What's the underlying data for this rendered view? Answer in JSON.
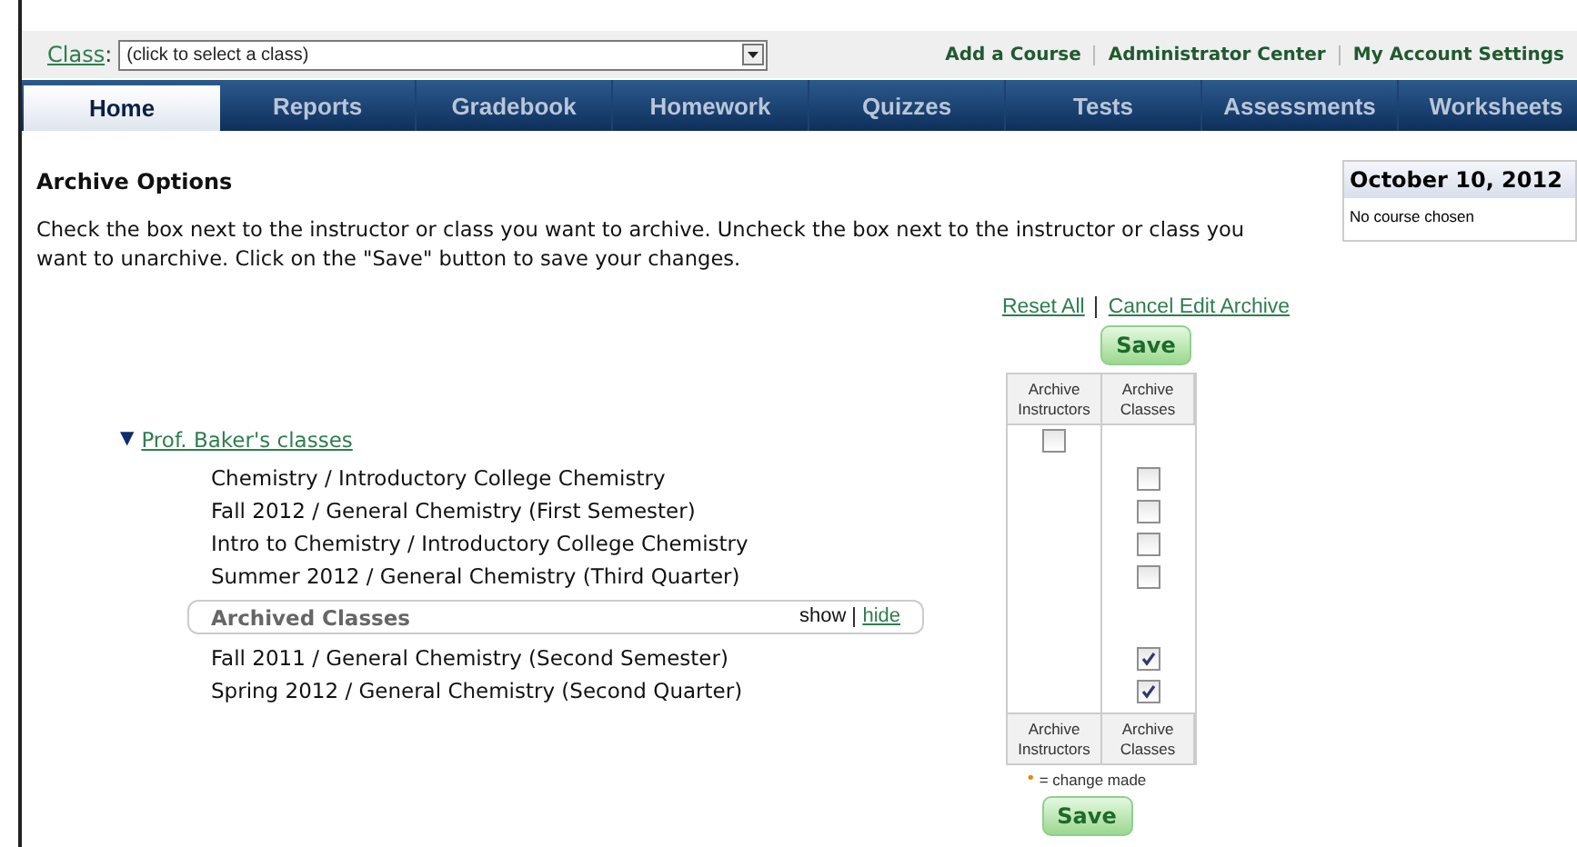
{
  "class_selector": {
    "label": "Class",
    "suffix": ":",
    "placeholder": "(click to select a class)"
  },
  "top_links": [
    "Add a Course",
    "Administrator Center",
    "My Account Settings"
  ],
  "tabs": [
    {
      "label": "Home",
      "selected": true
    },
    {
      "label": "Reports",
      "selected": false
    },
    {
      "label": "Gradebook",
      "selected": false
    },
    {
      "label": "Homework",
      "selected": false
    },
    {
      "label": "Quizzes",
      "selected": false
    },
    {
      "label": "Tests",
      "selected": false
    },
    {
      "label": "Assessments",
      "selected": false
    },
    {
      "label": "Worksheets",
      "selected": false
    }
  ],
  "page_title": "Archive Options",
  "instructions": "Check the box next to the instructor or class you want to archive. Uncheck the box next to the instructor or class you want to unarchive. Click on the \"Save\" button to save your changes.",
  "action_links": [
    "Reset All",
    "Cancel Edit Archive"
  ],
  "save_top": "Save",
  "table_header": [
    "Archive Instructors",
    "Archive Classes"
  ],
  "instructor": {
    "toggle": "▼",
    "name": "Prof. Baker's classes",
    "checked": false
  },
  "classes": [
    {
      "name": "Chemistry / Introductory College Chemistry",
      "checked": false
    },
    {
      "name": "Fall 2012 / General Chemistry (First Semester)",
      "checked": false
    },
    {
      "name": "Intro to Chemistry / Introductory College Chemistry",
      "checked": false
    },
    {
      "name": "Summer 2012 / General Chemistry (Third Quarter)",
      "checked": false
    }
  ],
  "archived": {
    "title": "Archived Classes",
    "show": "show",
    "hide": "hide",
    "classes": [
      {
        "name": "Fall 2011 / General Chemistry (Second Semester)",
        "checked": true
      },
      {
        "name": "Spring 2012 / General Chemistry (Second Quarter)",
        "checked": true
      }
    ]
  },
  "table_footer": [
    "Archive Instructors",
    "Archive Classes"
  ],
  "legend": {
    "mark": "•",
    "text": "= change made"
  },
  "save_bottom": "Save",
  "date_box": {
    "date": "October 10, 2012",
    "message": "No course chosen"
  }
}
